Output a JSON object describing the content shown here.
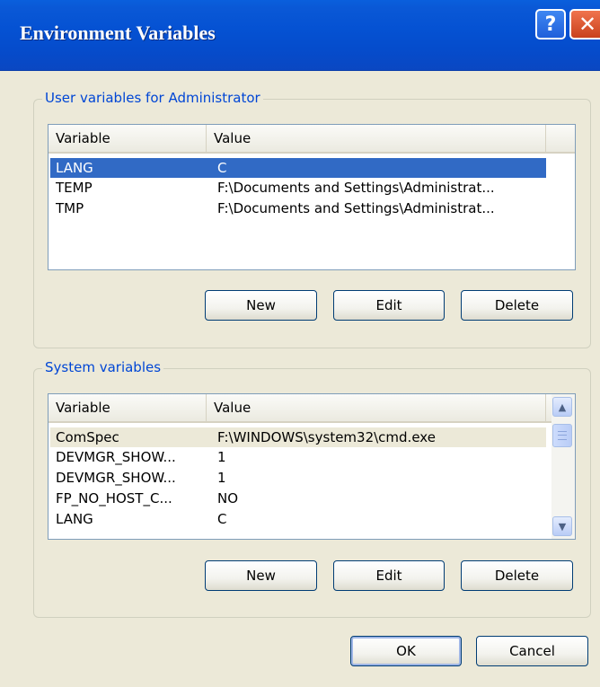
{
  "window": {
    "title": "Environment Variables",
    "help_glyph": "?",
    "close_glyph": "✕"
  },
  "user_group": {
    "legend": "User variables for Administrator",
    "columns": [
      "Variable",
      "Value"
    ],
    "rows": [
      {
        "variable": "LANG",
        "value": "C",
        "selected": true
      },
      {
        "variable": "TEMP",
        "value": "F:\\Documents and Settings\\Administrat..."
      },
      {
        "variable": "TMP",
        "value": "F:\\Documents and Settings\\Administrat..."
      }
    ],
    "buttons": {
      "new": "New",
      "edit": "Edit",
      "delete": "Delete"
    }
  },
  "system_group": {
    "legend": "System variables",
    "columns": [
      "Variable",
      "Value"
    ],
    "rows": [
      {
        "variable": "ComSpec",
        "value": "F:\\WINDOWS\\system32\\cmd.exe",
        "selected": true
      },
      {
        "variable": "DEVMGR_SHOW...",
        "value": "1"
      },
      {
        "variable": "DEVMGR_SHOW...",
        "value": "1"
      },
      {
        "variable": "FP_NO_HOST_C...",
        "value": "NO"
      },
      {
        "variable": "LANG",
        "value": "C"
      }
    ],
    "buttons": {
      "new": "New",
      "edit": "Edit",
      "delete": "Delete"
    }
  },
  "footer": {
    "ok": "OK",
    "cancel": "Cancel"
  }
}
